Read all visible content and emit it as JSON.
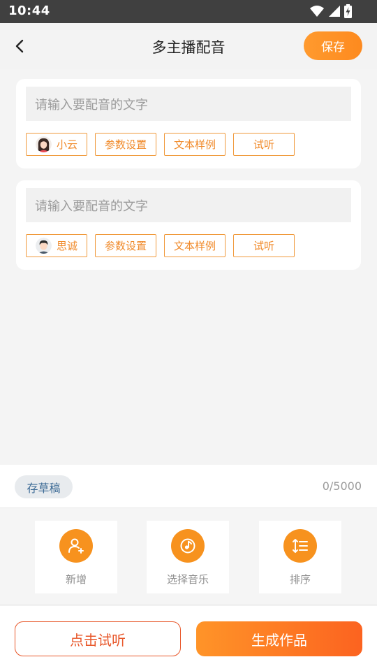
{
  "status": {
    "time": "10:44"
  },
  "header": {
    "title": "多主播配音",
    "save_label": "保存"
  },
  "cards": [
    {
      "placeholder": "请输入要配音的文字",
      "voice": "小云",
      "params": "参数设置",
      "sample": "文本样例",
      "listen": "试听"
    },
    {
      "placeholder": "请输入要配音的文字",
      "voice": "思诚",
      "params": "参数设置",
      "sample": "文本样例",
      "listen": "试听"
    }
  ],
  "draft": {
    "label": "存草稿",
    "counter": "0/5000"
  },
  "tools": [
    {
      "label": "新增",
      "icon": "add-user-icon"
    },
    {
      "label": "选择音乐",
      "icon": "music-disc-icon"
    },
    {
      "label": "排序",
      "icon": "sort-icon"
    }
  ],
  "actions": {
    "preview": "点击试听",
    "generate": "生成作品"
  },
  "colors": {
    "accent": "#f7921e",
    "chip_text": "#f08a2a",
    "generate_end": "#fc6320",
    "draft_text": "#3d6b96"
  }
}
